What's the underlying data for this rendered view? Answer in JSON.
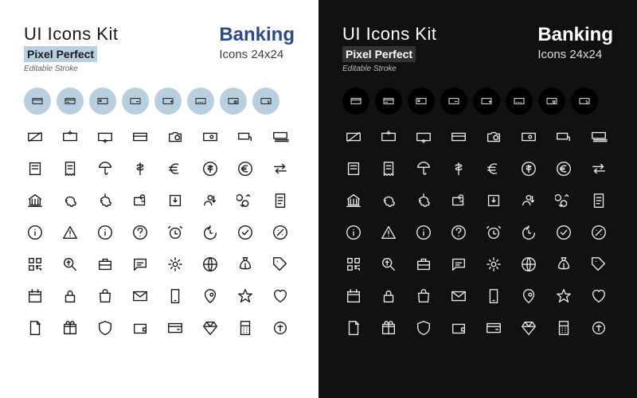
{
  "header": {
    "title": "UI Icons Kit",
    "subtitle": "Pixel Perfect",
    "editable": "Editable Stroke",
    "category": "Banking",
    "dimensions": "Icons 24x24"
  },
  "feature_icons": [
    "card-basic",
    "card-line",
    "card-chip",
    "card-chat",
    "card-plus",
    "card-dots",
    "card-heart",
    "card-tag"
  ],
  "grid_icons": [
    "card-slash",
    "card-down",
    "card-up",
    "card",
    "camera",
    "cash",
    "cash-hand",
    "cash-stack",
    "atm",
    "receipt",
    "umbrella",
    "dollar",
    "euro",
    "dollar-circle",
    "euro-circle",
    "transfer",
    "bank",
    "piggy",
    "piggy-coin",
    "wallet-sync",
    "deposit",
    "user-money",
    "coins-swap",
    "statement",
    "info-circle",
    "warning",
    "info",
    "question",
    "alarm",
    "history",
    "check-circle",
    "percent",
    "qr",
    "search-dollar",
    "briefcase",
    "chat",
    "gear",
    "globe",
    "money-bag",
    "tag",
    "calendar",
    "lock",
    "shopping-bag",
    "mail",
    "phone",
    "pin",
    "star",
    "heart",
    "document",
    "gift",
    "shield",
    "wallet",
    "card-alt",
    "diamond",
    "calculator",
    "coin"
  ]
}
